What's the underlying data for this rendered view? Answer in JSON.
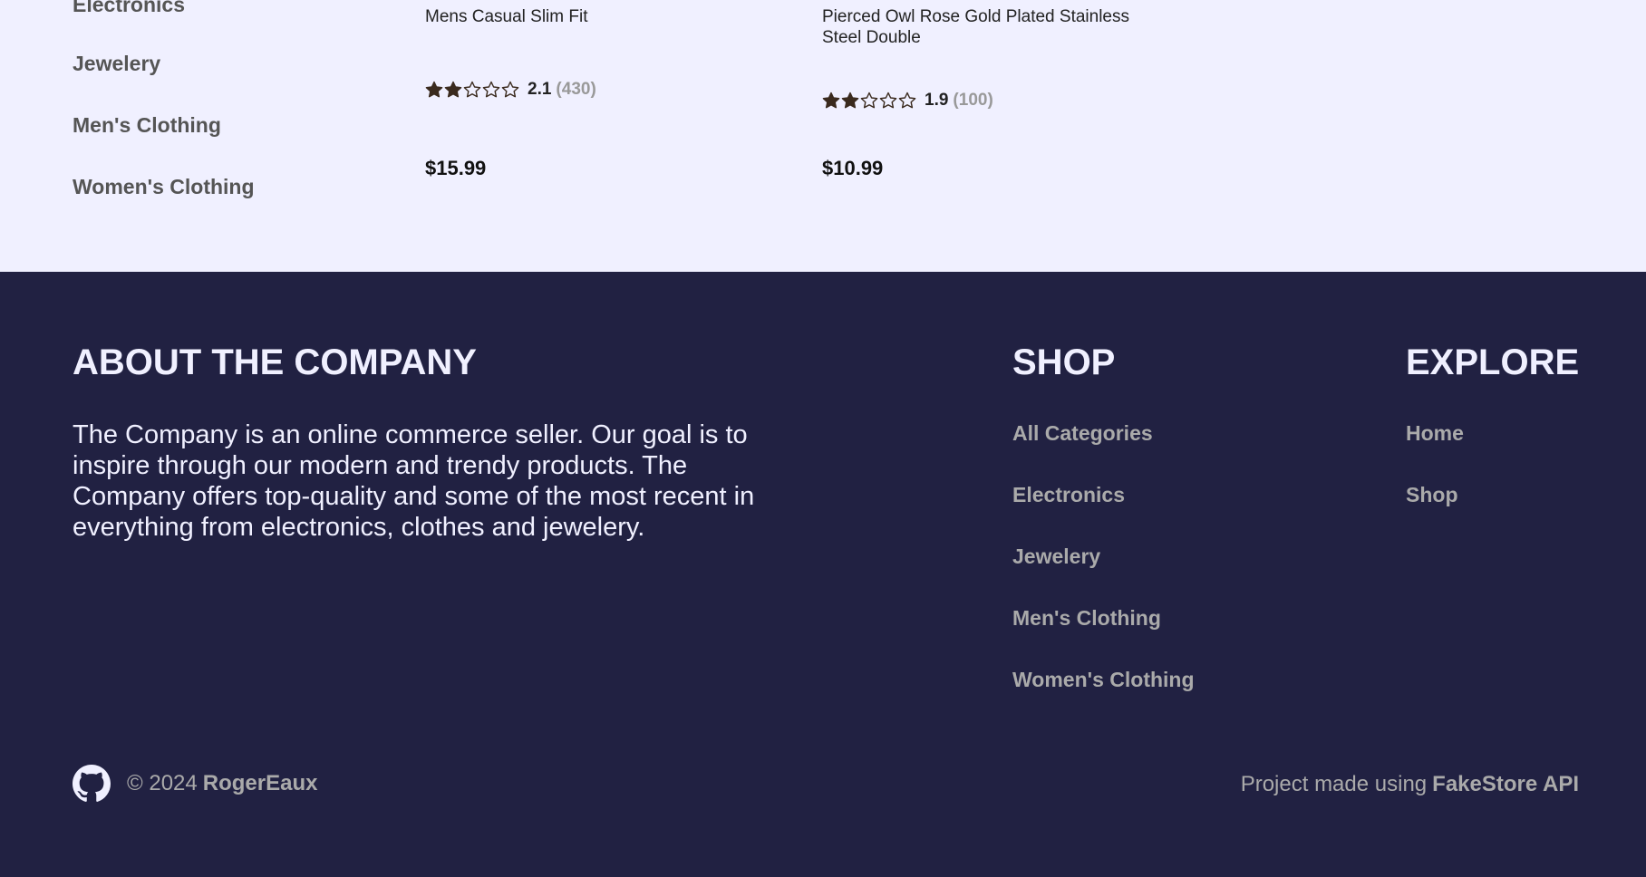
{
  "sidebar": {
    "categories": [
      "Electronics",
      "Jewelery",
      "Men's Clothing",
      "Women's Clothing"
    ]
  },
  "products": [
    {
      "name": "Mens Casual Slim Fit",
      "rating": 2.1,
      "rating_display": "2.1",
      "rating_count": "(430)",
      "price": "$15.99"
    },
    {
      "name": "Pierced Owl Rose Gold Plated Stainless Steel Double",
      "rating": 1.9,
      "rating_display": "1.9",
      "rating_count": "(100)",
      "price": "$10.99"
    }
  ],
  "footer": {
    "about": {
      "heading": "ABOUT THE COMPANY",
      "text": "The Company is an online commerce seller. Our goal is to inspire through our modern and trendy products. The Company offers top-quality and some of the most recent in everything from electronics, clothes and jewelery."
    },
    "shop": {
      "heading": "SHOP",
      "links": [
        "All Categories",
        "Electronics",
        "Jewelery",
        "Men's Clothing",
        "Women's Clothing"
      ]
    },
    "explore": {
      "heading": "EXPLORE",
      "links": [
        "Home",
        "Shop"
      ]
    },
    "copyright": "© 2024",
    "author": "RogerEaux",
    "made_using_prefix": "Project made using",
    "made_using_link": "FakeStore API",
    "github_icon": "github-icon"
  },
  "colors": {
    "page_bg": "#f0f0ff",
    "footer_bg": "#212142",
    "star": "#3a2a1e",
    "muted": "#aaaaaa"
  }
}
